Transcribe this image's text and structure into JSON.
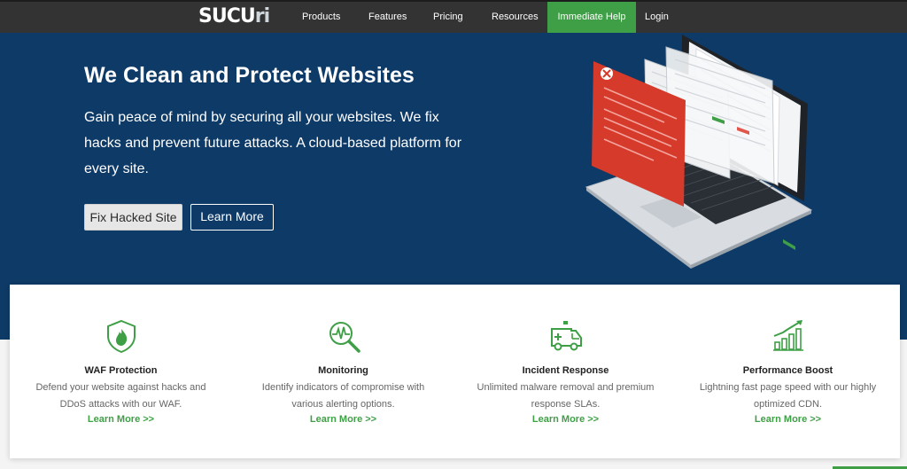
{
  "brand": {
    "logo_main": "SUCU",
    "logo_dim": "ri"
  },
  "nav": {
    "items": [
      "Products",
      "Features",
      "Pricing",
      "Resources"
    ],
    "cta": "Immediate Help",
    "login": "Login"
  },
  "hero": {
    "title": "We Clean and Protect Websites",
    "subtitle": "Gain peace of mind by securing all your websites. We fix hacks and prevent future attacks. A cloud-based platform for every site.",
    "primary_button": "Fix Hacked Site",
    "secondary_button": "Learn More"
  },
  "features": [
    {
      "icon": "shield-flame-icon",
      "title": "WAF Protection",
      "desc": "Defend your website against hacks and DDoS attacks with our WAF.",
      "link": "Learn More >>"
    },
    {
      "icon": "magnifier-pulse-icon",
      "title": "Monitoring",
      "desc": "Identify indicators of compromise with various alerting options.",
      "link": "Learn More >>"
    },
    {
      "icon": "ambulance-icon",
      "title": "Incident Response",
      "desc": "Unlimited malware removal and premium response SLAs.",
      "link": "Learn More >>"
    },
    {
      "icon": "growth-chart-icon",
      "title": "Performance Boost",
      "desc": "Lightning fast page speed with our highly optimized CDN.",
      "link": "Learn More >>"
    }
  ],
  "colors": {
    "nav_bg": "#333333",
    "hero_bg": "#0e3a67",
    "accent_green": "#3f9f46",
    "alert_red": "#d63a2b"
  }
}
